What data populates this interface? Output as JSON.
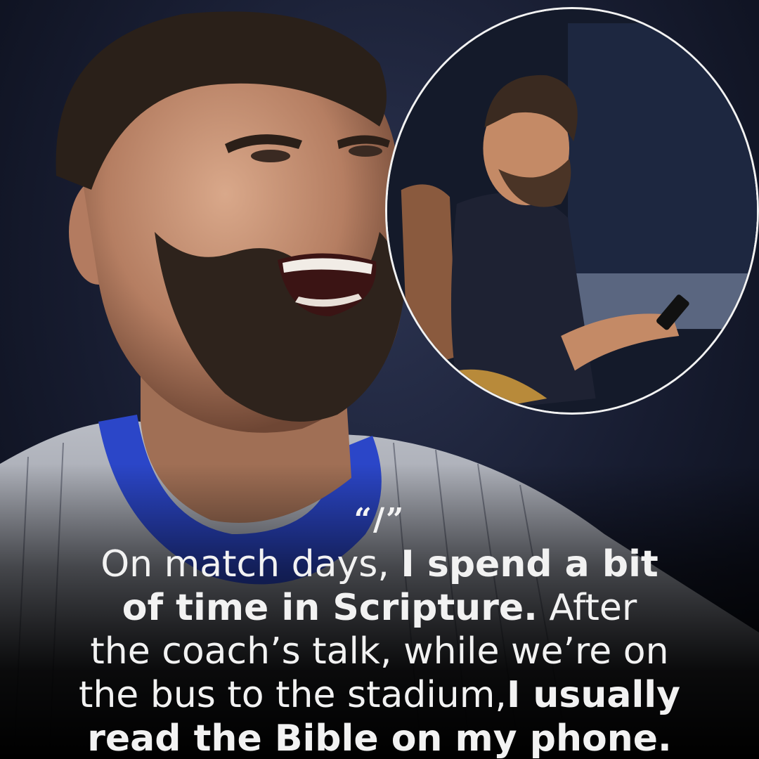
{
  "quote_mark": "“/”",
  "quote": {
    "line1_regular": "On match days, ",
    "line1_bold": "I spend a bit",
    "line2_bold": "of time in Scripture.",
    "line2_regular": " After",
    "line3_regular": "the coach’s talk, while we’re on",
    "line4_regular": "the bus to the stadium,",
    "line4_bold": "I usually",
    "line5_bold": "read the Bible on my phone."
  },
  "colors": {
    "background": "#171c30",
    "text": "#f2f2f2",
    "jersey_blue": "#2b46c8",
    "inset_border": "#f2f2f2"
  }
}
